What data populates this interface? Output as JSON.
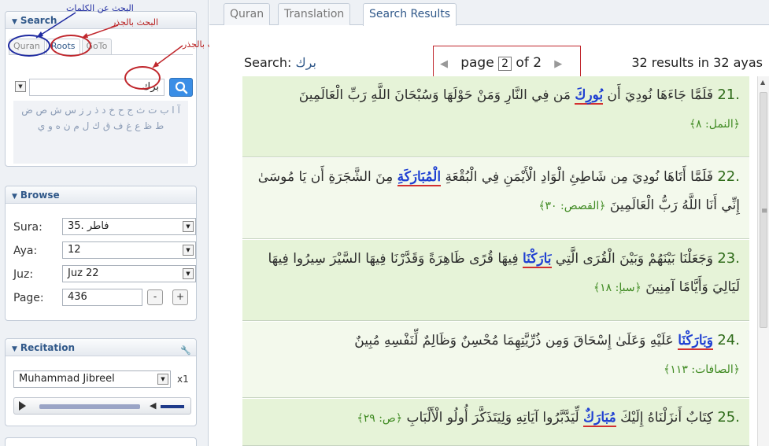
{
  "sidebar": {
    "search": {
      "title": "Search",
      "tabs": [
        "Quran",
        "Roots",
        "GoTo"
      ],
      "query": "برك",
      "letters": "آ ا ب ت ث ج ح خ د ذ ر ز س ش ص ض ط ظ ع غ ف ق ك ل م ن ه و ي"
    },
    "browse": {
      "title": "Browse",
      "sura_label": "Sura:",
      "sura_value": "35. فاطر",
      "aya_label": "Aya:",
      "aya_value": "12",
      "juz_label": "Juz:",
      "juz_value": "Juz 22",
      "page_label": "Page:",
      "page_value": "436",
      "minus": "-",
      "plus": "+"
    },
    "recitation": {
      "title": "Recitation",
      "reciter": "Muhammad Jibreel",
      "speed": "x1"
    }
  },
  "annotations": {
    "words": "البحث عن الكلمات",
    "roots": "البحث بالجذر",
    "example": "مثال للبحث بالجذر"
  },
  "main": {
    "tabs": [
      "Quran",
      "Translation",
      "Search Results"
    ],
    "search_label": "Search:",
    "search_query": "برك",
    "pager": {
      "page_word": "page",
      "current": "2",
      "of_word": "of",
      "total": "2"
    },
    "results_text": "32 results in 32 ayas",
    "ayas": [
      {
        "num": "21.",
        "before": "فَلَمَّا جَاءَهَا نُودِيَ أَن ",
        "hl": "بُورِكَ",
        "after": " مَن فِي النَّارِ وَمَنْ حَوْلَهَا وَسُبْحَانَ اللَّهِ رَبِّ الْعَالَمِينَ",
        "ref": "﴿النمل: ٨﴾"
      },
      {
        "num": "22.",
        "before": "فَلَمَّا أَتَاهَا نُودِيَ مِن شَاطِئِ الْوَادِ الْأَيْمَنِ فِي الْبُقْعَةِ ",
        "hl": "الْمُبَارَكَةِ",
        "after": " مِنَ الشَّجَرَةِ أَن يَا مُوسَىٰ إِنِّي أَنَا اللَّهُ رَبُّ الْعَالَمِينَ",
        "ref": "﴿القصص: ٣٠﴾"
      },
      {
        "num": "23.",
        "before": "وَجَعَلْنَا بَيْنَهُمْ وَبَيْنَ الْقُرَى الَّتِي ",
        "hl": "بَارَكْنَا",
        "after": " فِيهَا قُرًى ظَاهِرَةً وَقَدَّرْنَا فِيهَا السَّيْرَ سِيرُوا فِيهَا لَيَالِيَ وَأَيَّامًا آمِنِينَ",
        "ref": "﴿سبإ: ١٨﴾"
      },
      {
        "num": "24.",
        "before": "",
        "hl": "وَبَارَكْنَا",
        "after": " عَلَيْهِ وَعَلَىٰ إِسْحَاقَ وَمِن ذُرِّيَّتِهِمَا مُحْسِنٌ وَظَالِمٌ لِّنَفْسِهِ مُبِينٌ",
        "ref": "﴿الصافات: ١١٣﴾"
      },
      {
        "num": "25.",
        "before": "كِتَابٌ أَنزَلْنَاهُ إِلَيْكَ ",
        "hl": "مُبَارَكٌ",
        "after": " لِّيَدَّبَّرُوا آيَاتِهِ وَلِيَتَذَكَّرَ أُولُو الْأَلْبَابِ",
        "ref": "﴿ص: ٢٩﴾"
      }
    ]
  }
}
